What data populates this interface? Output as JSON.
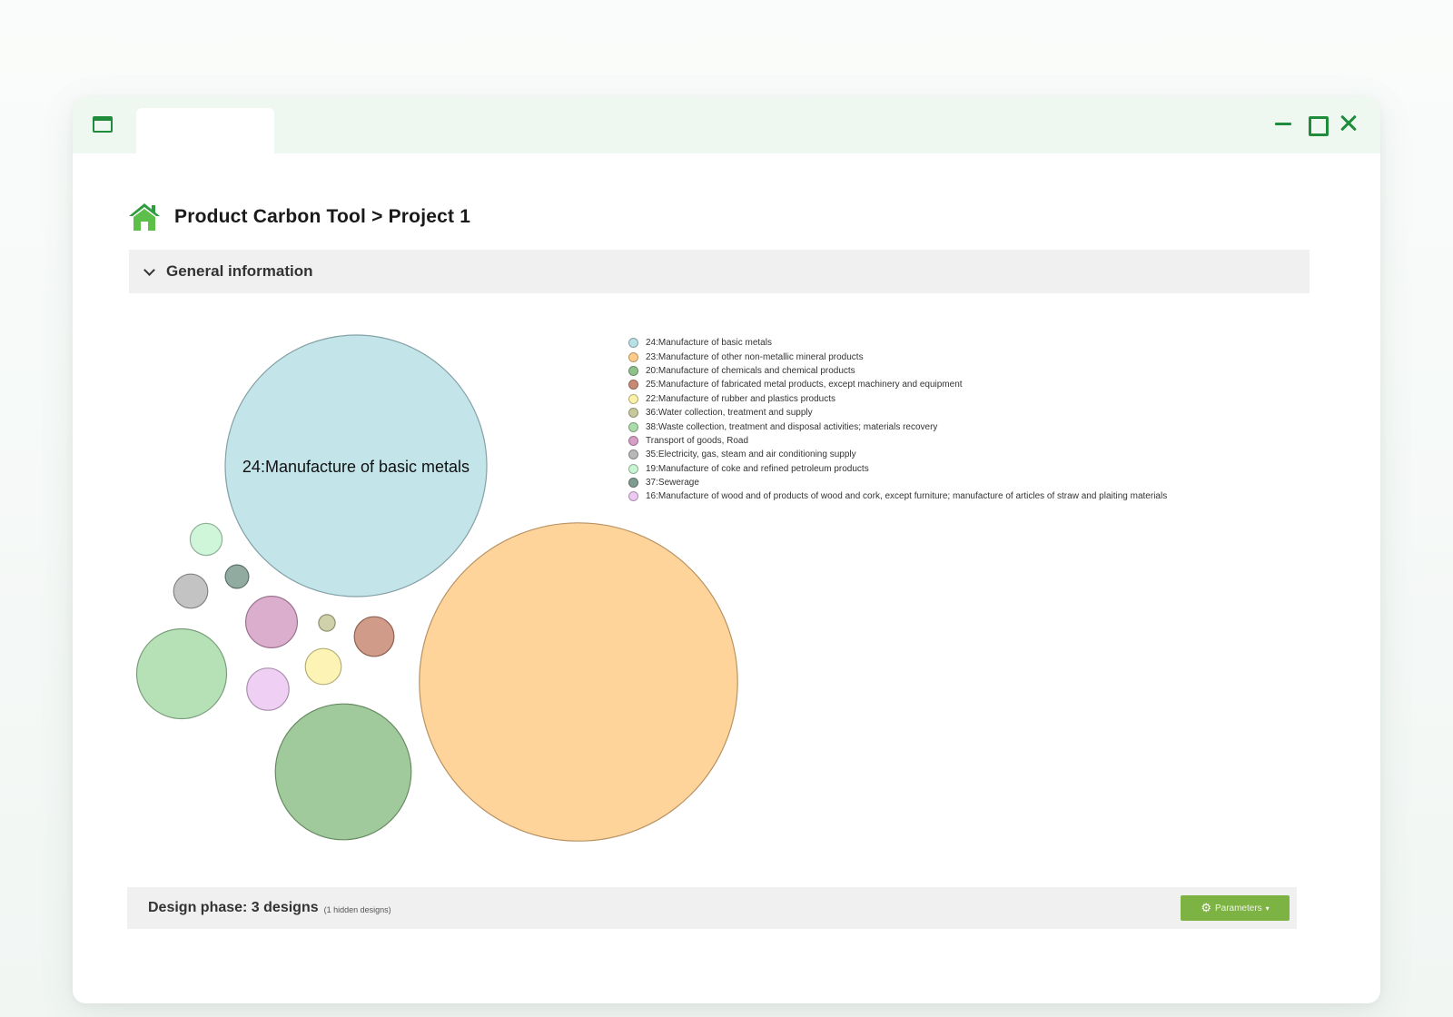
{
  "breadcrumb": {
    "text": "Product Carbon Tool > Project 1"
  },
  "general_section": {
    "title": "General information"
  },
  "footer": {
    "title": "Design phase: 3 designs",
    "note": "(1 hidden designs)",
    "params_label": "Parameters"
  },
  "icons": [
    "window-icon",
    "home-icon",
    "chevron-down-icon",
    "gear-icon",
    "minimize-icon",
    "maximize-icon",
    "close-icon"
  ],
  "colors": {
    "accent": "#1e8c3a",
    "button": "#7cb342"
  },
  "chart_data": {
    "type": "bubble",
    "legend_position": "right",
    "bubble_label": "24:Manufacture of basic metals",
    "series": [
      {
        "name": "24:Manufacture of basic metals",
        "value": 100,
        "color": "#b8e0e6"
      },
      {
        "name": "23:Manufacture of other non-metallic mineral products",
        "value": 148,
        "color": "#ffcc8a"
      },
      {
        "name": "20:Manufacture of chemicals and chemical products",
        "value": 27,
        "color": "#8fc18a"
      },
      {
        "name": "25:Manufacture of fabricated metal products, except machinery and equipment",
        "value": 2.3,
        "color": "#c98a74"
      },
      {
        "name": "22:Manufacture of rubber and plastics products",
        "value": 1.9,
        "color": "#fbf1a8"
      },
      {
        "name": "36:Water collection, treatment and supply",
        "value": 0.4,
        "color": "#c7c99c"
      },
      {
        "name": "38:Waste collection, treatment and disposal activities; materials recovery",
        "value": 11.8,
        "color": "#a9dcaa"
      },
      {
        "name": "Transport of goods, Road",
        "value": 3.9,
        "color": "#d6a0c6"
      },
      {
        "name": "35:Electricity, gas, steam and air conditioning supply",
        "value": 1.7,
        "color": "#b8b8b8"
      },
      {
        "name": "19:Manufacture of coke and refined petroleum products",
        "value": 1.5,
        "color": "#c8f5d2"
      },
      {
        "name": "37:Sewerage",
        "value": 0.8,
        "color": "#7f9c91"
      },
      {
        "name": "16:Manufacture of wood and of products of wood and cork, except furniture; manufacture of articles of straw and plaiting materials",
        "value": 2.6,
        "color": "#ecc8f2"
      }
    ]
  }
}
